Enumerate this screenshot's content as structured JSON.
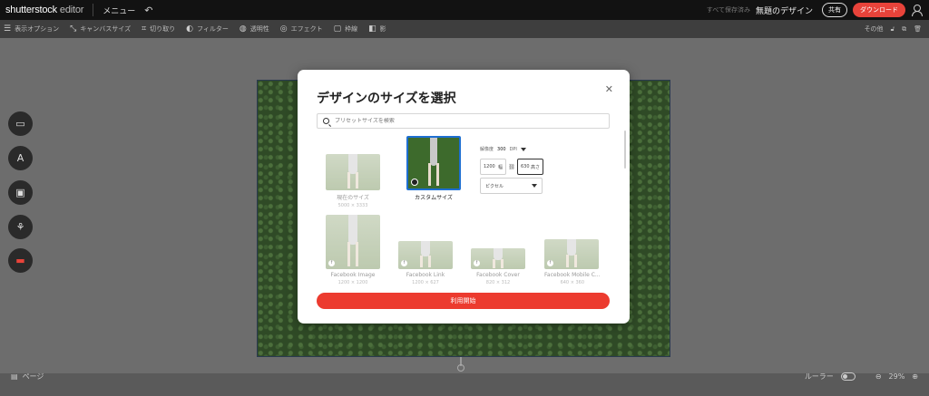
{
  "topbar": {
    "logo_text": "shutterstock",
    "logo_suffix": "editor",
    "menu_label": "メニュー",
    "autosave_text": "すべて保存済み",
    "design_title": "無題のデザイン",
    "share_label": "共有",
    "download_label": "ダウンロード"
  },
  "toolbar": {
    "items": [
      {
        "icon": "☰",
        "label": "表示オプション"
      },
      {
        "icon": "⤡",
        "label": "キャンバスサイズ"
      },
      {
        "icon": "⌗",
        "label": "切り取り"
      },
      {
        "icon": "◐",
        "label": "フィルター"
      },
      {
        "icon": "◍",
        "label": "透明性"
      },
      {
        "icon": "◎",
        "label": "エフェクト"
      },
      {
        "icon": "▢",
        "label": "枠線"
      },
      {
        "icon": "◧",
        "label": "影"
      }
    ],
    "more_label": "その他"
  },
  "side_buttons": [
    {
      "name": "image",
      "icon": "▭"
    },
    {
      "name": "text",
      "icon": "A"
    },
    {
      "name": "template",
      "icon": "▣"
    },
    {
      "name": "elements",
      "icon": "⚘"
    },
    {
      "name": "upload",
      "icon": "▬"
    }
  ],
  "bottombar": {
    "pages_label": "ページ",
    "ruler_label": "ルーラー",
    "zoom": "29%"
  },
  "modal": {
    "title": "デザインのサイズを選択",
    "search_placeholder": "プリセットサイズを検索",
    "presets": [
      {
        "label": "現在のサイズ",
        "size": "5000 × 3333",
        "icon": ""
      },
      {
        "label": "カスタムサイズ",
        "size": "",
        "icon": "custom"
      },
      {
        "label": "Facebook Image",
        "size": "1200 × 1200",
        "icon": "f"
      },
      {
        "label": "Facebook Link",
        "size": "1200 × 627",
        "icon": "f"
      },
      {
        "label": "Facebook Cover",
        "size": "820 × 312",
        "icon": "f"
      },
      {
        "label": "Facebook Mobile C...",
        "size": "640 × 360",
        "icon": "f"
      }
    ],
    "custom": {
      "resolution_label": "解像度",
      "resolution_value": "300",
      "resolution_unit": "DPI",
      "width_value": "1200",
      "width_label": "幅",
      "height_value": "630",
      "height_label": "高さ",
      "unit_value": "ピクセル"
    },
    "start_label": "利用開始"
  }
}
